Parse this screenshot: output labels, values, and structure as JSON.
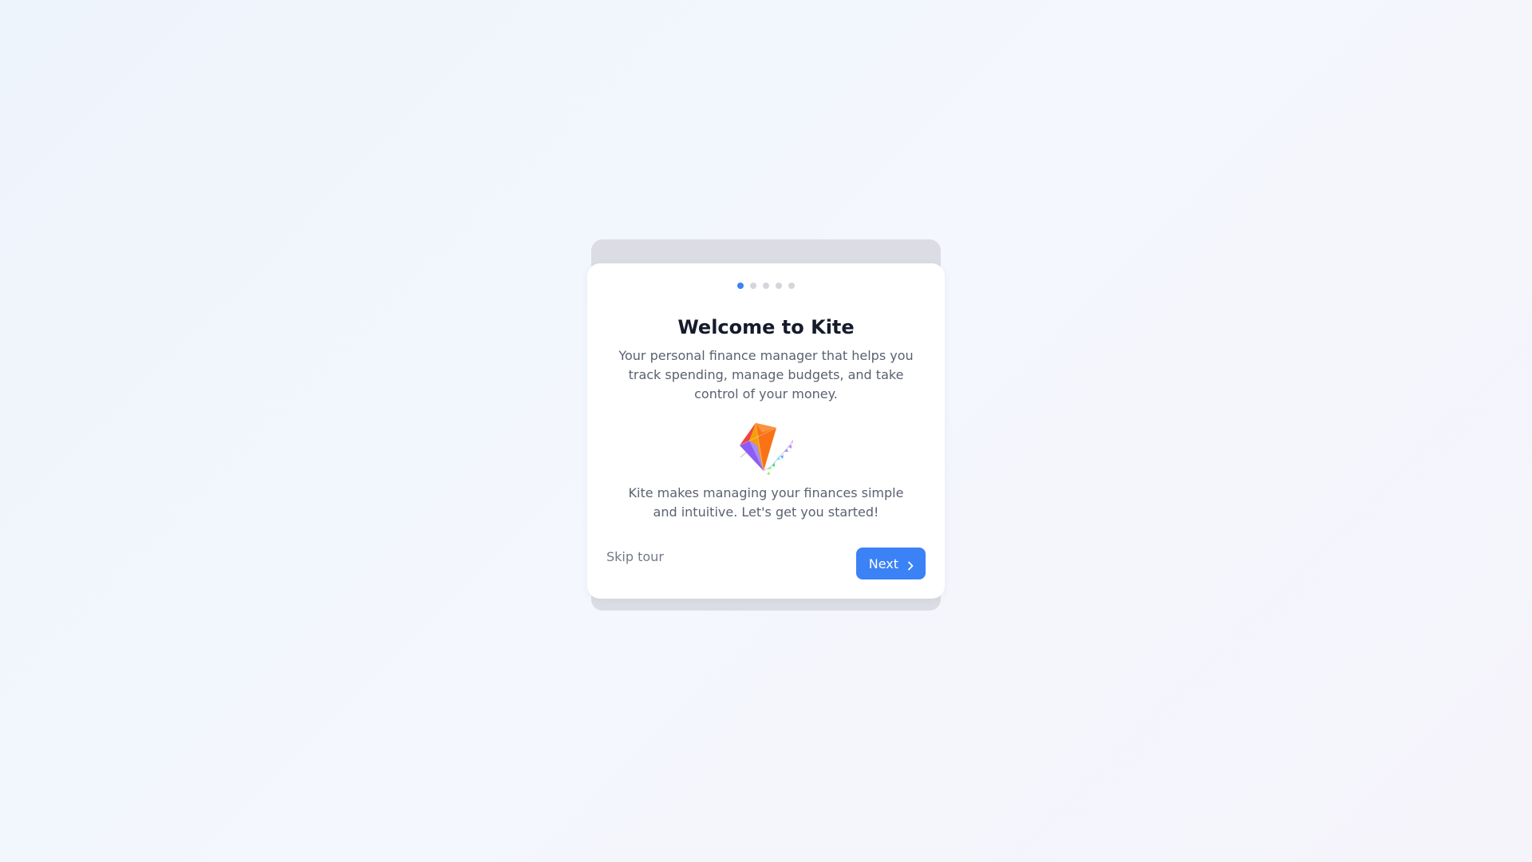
{
  "tour": {
    "total_steps": 5,
    "current_step": 1,
    "title": "Welcome to Kite",
    "subtitle": "Your personal finance manager that helps you track spending, manage budgets, and take control of your money.",
    "illustration": "kite-icon",
    "body": "Kite makes managing your finances simple and intuitive. Let's get you started!",
    "skip_label": "Skip tour",
    "next_label": "Next",
    "next_icon": "chevron-right-icon"
  },
  "colors": {
    "accent": "#3b82f6",
    "dot_inactive": "#d4d6dc",
    "title": "#151b2b",
    "text": "#5a6171",
    "muted": "#737986"
  }
}
